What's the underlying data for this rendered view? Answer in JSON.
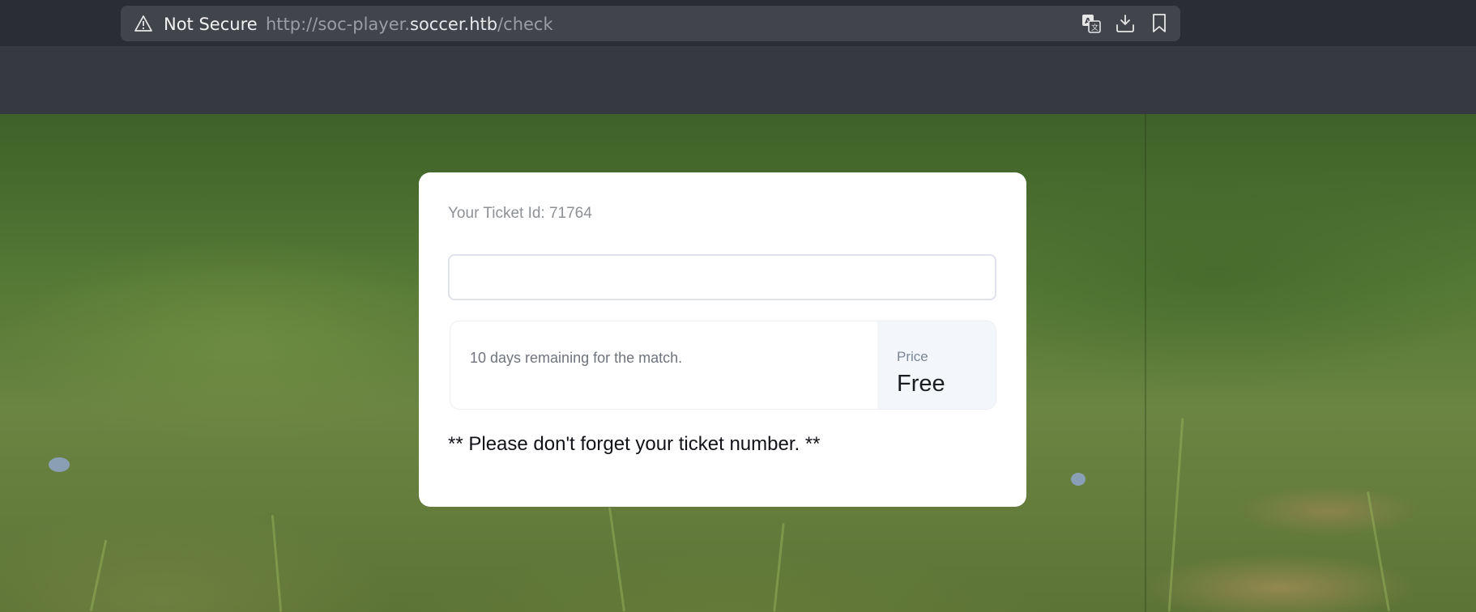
{
  "browser": {
    "security_label": "Not Secure",
    "url_scheme": "http://soc-player.",
    "url_host": "soccer.htb",
    "url_path": "/check"
  },
  "card": {
    "ticket_id_text": "Your Ticket Id: 71764",
    "input_value": "",
    "remaining_text": "10 days remaining for the match.",
    "price_label": "Price",
    "price_value": "Free",
    "reminder_text": "** Please don't forget your ticket number. **"
  },
  "icons": {
    "security": "warning-triangle-icon",
    "translate": "translate-icon",
    "download": "download-icon",
    "bookmark": "bookmark-icon"
  },
  "colors": {
    "chrome_bg": "#2b2d34",
    "urlbar_bg": "#42444c",
    "toolbar_bg": "#363941",
    "card_bg": "#ffffff",
    "price_bg": "#f3f6fb"
  }
}
